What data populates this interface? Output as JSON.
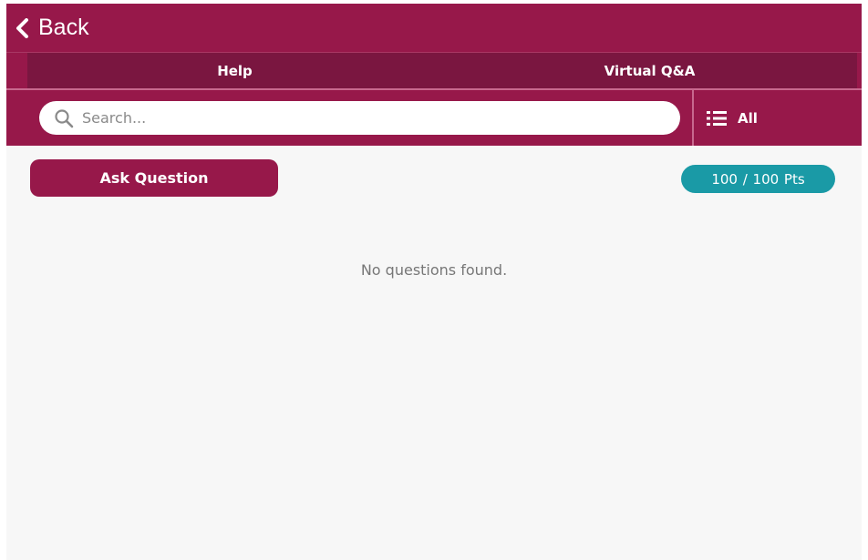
{
  "header": {
    "back_label": "Back",
    "back_icon": "chevron-left-icon"
  },
  "tabs": [
    {
      "label": "Help"
    },
    {
      "label": "Virtual Q&A"
    }
  ],
  "search": {
    "placeholder": "Search...",
    "value": "",
    "icon": "search-icon"
  },
  "filter": {
    "label": "All",
    "icon": "list-icon"
  },
  "actions": {
    "ask_question_label": "Ask Question"
  },
  "points": {
    "label": "100 / 100  Pts"
  },
  "content": {
    "empty_message": "No questions found."
  },
  "colors": {
    "primary": "#97184a",
    "tab_bar": "#7a1640",
    "badge": "#1a9aa6",
    "background": "#f7f7f7"
  }
}
